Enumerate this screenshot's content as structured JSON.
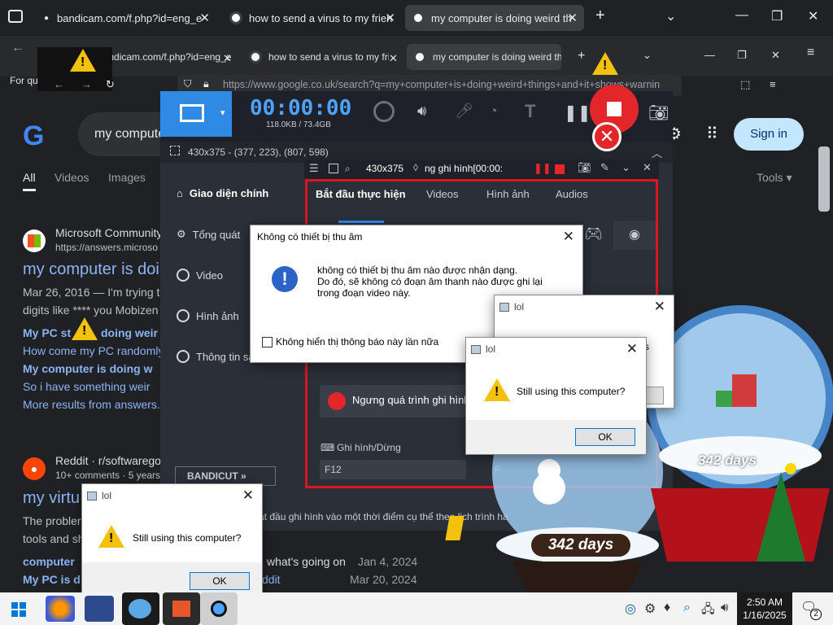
{
  "tabs": [
    {
      "label": "bandicam.com/f.php?id=eng_e"
    },
    {
      "label": "how to send a virus to my frien"
    },
    {
      "label": "my computer is doing weird th"
    }
  ],
  "tabs_ghost": [
    {
      "label": "bandicam.com/f.php?id=eng_e"
    },
    {
      "label": "how to send a virus to my frien"
    },
    {
      "label": "my computer is doing weird th"
    }
  ],
  "bookmark": "For quic",
  "url": "https://www.google.co.uk/search?q=my+computer+is+doing+weird+things+and+it+shows+warnin",
  "google": {
    "search_text": "my compute",
    "sign_in": "Sign in",
    "tabs": [
      "All",
      "Videos",
      "Images"
    ],
    "tools": "Tools",
    "r1_site": "Microsoft Community",
    "r1_url": "https://answers.microso",
    "r1_title": "my computer is doi",
    "r1_snip1": "Mar 26, 2016 — I'm trying t",
    "r1_snip2": "digits like **** you Mobizen",
    "r1_l1a": "My PC st",
    "r1_l1b": "doing weir",
    "r1_l2": "How come my PC randomly",
    "r1_l3": "My computer is doing w",
    "r1_l4": "So i have something weir",
    "r1_more": "More results from answers.",
    "r2_site": "Reddit · r/softwarego",
    "r2_meta": "10+ comments · 5 years",
    "r2_title": "my virtu",
    "r2_snip1": "The probler",
    "r2_snip2": "tools and sh",
    "r2_l1": "computer",
    "r2_l1b": "what's going on",
    "r2_l1d": "Jan 4, 2024",
    "r2_l2": "My PC is d",
    "r2_l2b": "ddit",
    "r2_l2d": "Mar 20, 2024"
  },
  "bandicam": {
    "timer": "00:00:00",
    "size": "118.0KB / 73.4GB",
    "region": "430x375 - (377, 223), (807, 598)",
    "side": [
      "Giao diện chính",
      "Tổng quát",
      "Video",
      "Hình ảnh",
      "Thông tin sả"
    ],
    "tabs": [
      "Bắt đầu thực hiện",
      "Videos",
      "Hình ảnh",
      "Audios"
    ],
    "toolbar_size": "430x375",
    "toolbar_status": "ng ghi hình[00:00:",
    "stop_rec": "Ngưng quá trình ghi hình",
    "hotkey_label": "Ghi hình/Dừng",
    "hotkey_value": "F12",
    "hotkey_value2": "F",
    "bandicut": "BANDICUT",
    "bottom_text": "ắt đầu ghi hình vào một thời điểm cụ thể theo lịch trình hà"
  },
  "dialog_audio": {
    "title": "Không có thiết bị thu âm",
    "line1": "không có thiết bị thu âm nào được nhận dạng.",
    "line2": "Do đó, sẽ không có đoạn âm thanh nào được ghi lại",
    "line3": "trong đoạn video này.",
    "checkbox": "Không hiển thị thông báo này lần nữa"
  },
  "lol_dialogs": [
    {
      "title": "lol",
      "message": "Still using this computer?",
      "ok": "OK"
    },
    {
      "title": "lol",
      "message": "Still using this computer?",
      "ok": "OK"
    },
    {
      "title": "lol",
      "message": "",
      "ok": "",
      "partial": "s"
    }
  ],
  "globe": {
    "days": "342 days",
    "days2": "342 days"
  },
  "taskbar": {
    "time": "2:50 AM",
    "date": "1/16/2025",
    "notif": "2"
  },
  "colors": {
    "google_blue": "#8ab4f8",
    "bandicam_blue": "#2f8ae5",
    "record_red": "#e3262a",
    "highlight_red": "#e0141e"
  }
}
